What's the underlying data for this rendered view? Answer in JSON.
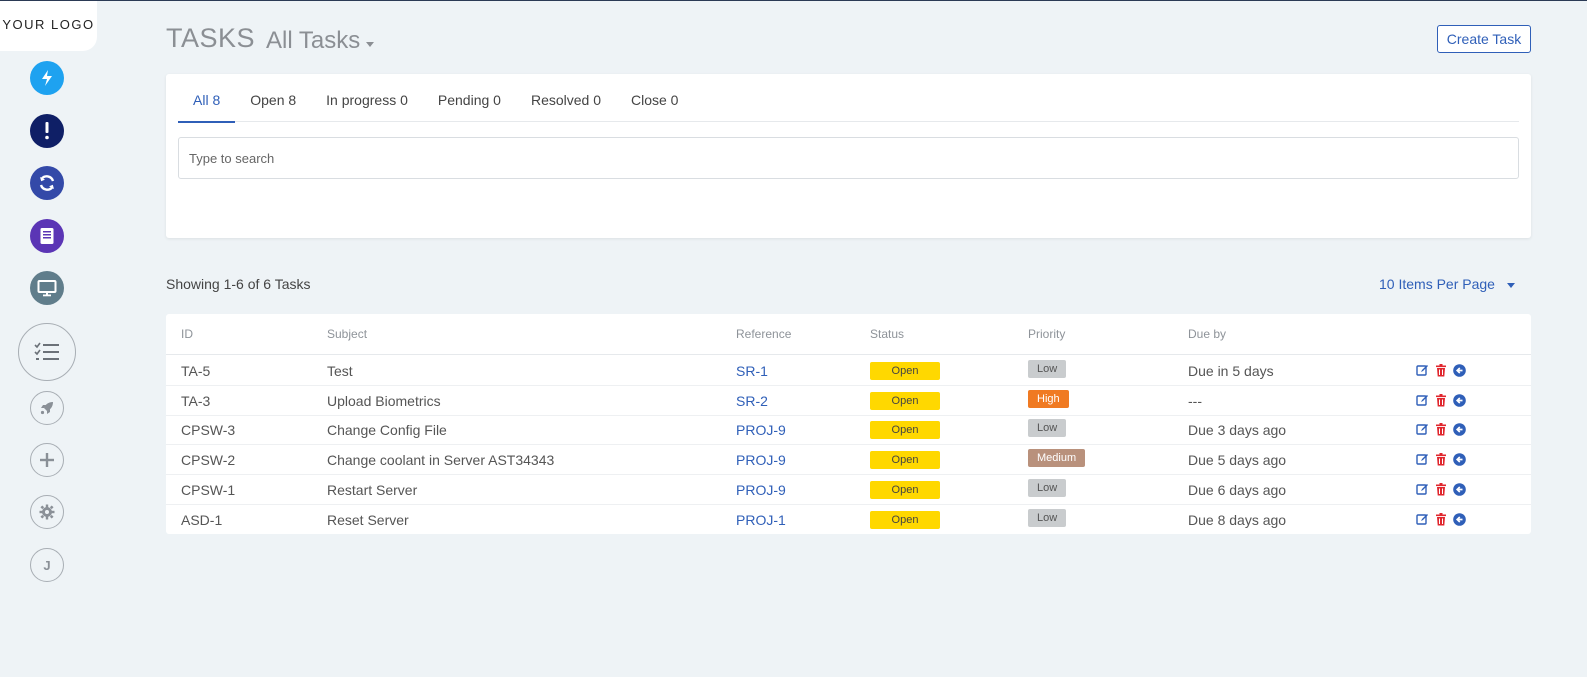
{
  "logo": "YOUR LOGO",
  "header": {
    "title": "TASKS",
    "view": "All Tasks",
    "create_label": "Create Task"
  },
  "tabs": [
    {
      "label": "All 8"
    },
    {
      "label": "Open 8"
    },
    {
      "label": "In progress 0"
    },
    {
      "label": "Pending 0"
    },
    {
      "label": "Resolved 0"
    },
    {
      "label": "Close 0"
    }
  ],
  "search": {
    "placeholder": "Type to search"
  },
  "summary": {
    "showing": "Showing 1-6 of 6 Tasks",
    "per_page": "10 Items Per Page"
  },
  "sidebar": {
    "user_initial": "J"
  },
  "table": {
    "headers": {
      "id": "ID",
      "subject": "Subject",
      "reference": "Reference",
      "status": "Status",
      "priority": "Priority",
      "due": "Due by"
    },
    "rows": [
      {
        "id": "TA-5",
        "subject": "Test",
        "reference": "SR-1",
        "status": "Open",
        "priority": "Low",
        "due": "Due in 5 days"
      },
      {
        "id": "TA-3",
        "subject": "Upload Biometrics",
        "reference": "SR-2",
        "status": "Open",
        "priority": "High",
        "due": "---"
      },
      {
        "id": "CPSW-3",
        "subject": "Change Config File",
        "reference": "PROJ-9",
        "status": "Open",
        "priority": "Low",
        "due": "Due 3 days ago"
      },
      {
        "id": "CPSW-2",
        "subject": "Change coolant in Server AST34343",
        "reference": "PROJ-9",
        "status": "Open",
        "priority": "Medium",
        "due": "Due 5 days ago"
      },
      {
        "id": "CPSW-1",
        "subject": "Restart Server",
        "reference": "PROJ-9",
        "status": "Open",
        "priority": "Low",
        "due": "Due 6 days ago"
      },
      {
        "id": "ASD-1",
        "subject": "Reset Server",
        "reference": "PROJ-1",
        "status": "Open",
        "priority": "Low",
        "due": "Due 8 days ago"
      }
    ]
  },
  "colors": {
    "accent": "#2f5fb8",
    "status_open": "#ffd800",
    "priority_low": "#c9ccce",
    "priority_high": "#f07a22",
    "priority_medium": "#b9917c",
    "icon_edit": "#2f5fb8",
    "icon_delete": "#e0262d",
    "icon_assign": "#2f5fb8"
  }
}
